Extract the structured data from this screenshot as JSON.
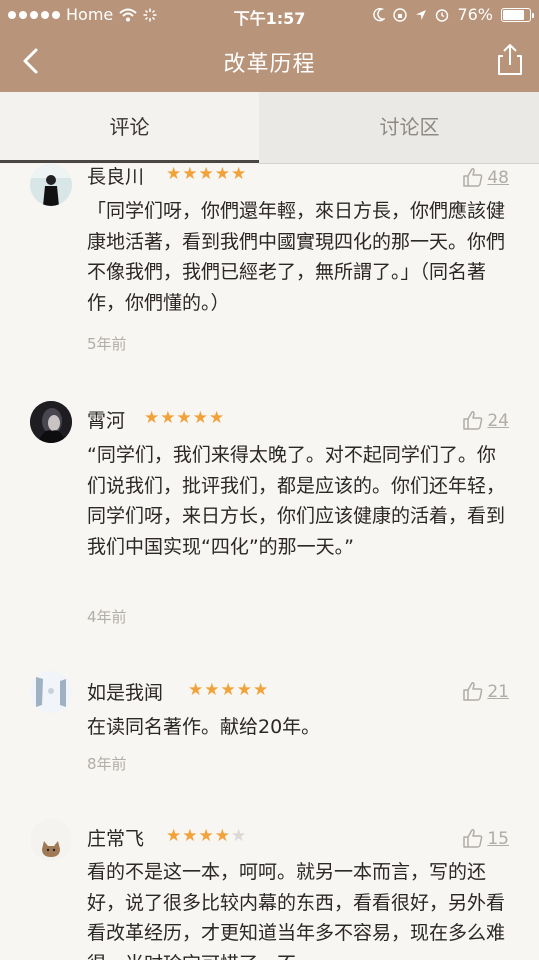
{
  "status_bar": {
    "carrier": "Home",
    "time": "下午1:57",
    "battery": "76%"
  },
  "nav": {
    "title": "改革历程",
    "back_icon": "chevron-left-icon",
    "share_icon": "share-icon"
  },
  "tabs": [
    {
      "label": "评论",
      "active": true
    },
    {
      "label": "讨论区",
      "active": false
    }
  ],
  "reviews": [
    {
      "user": "長良川",
      "rating": 5,
      "likes": "48",
      "text": "「同学们呀，你們還年輕，來日方長，你們應該健康地活著，看到我們中國實現四化的那一天。你們不像我們，我們已經老了，無所謂了。」（同名著作，你們懂的。）",
      "time": "5年前"
    },
    {
      "user": "霄河",
      "rating": 5,
      "likes": "24",
      "text": "“同学们，我们来得太晚了。对不起同学们了。你们说我们，批评我们，都是应该的。你们还年轻，同学们呀，来日方长，你们应该健康的活着，看到我们中国实现“四化”的那一天。”",
      "time": "4年前"
    },
    {
      "user": "如是我闻",
      "rating": 5,
      "likes": "21",
      "text": "在读同名著作。献给20年。",
      "time": "8年前"
    },
    {
      "user": "庄常飞",
      "rating": 4,
      "likes": "15",
      "text": "看的不是这一本，呵呵。就另一本而言，写的还好，说了很多比较内幕的东西，看看很好，另外看看改革经历，才更知道当年多不容易，现在多么难得，当时珍宝可惜了。不",
      "time": ""
    }
  ]
}
